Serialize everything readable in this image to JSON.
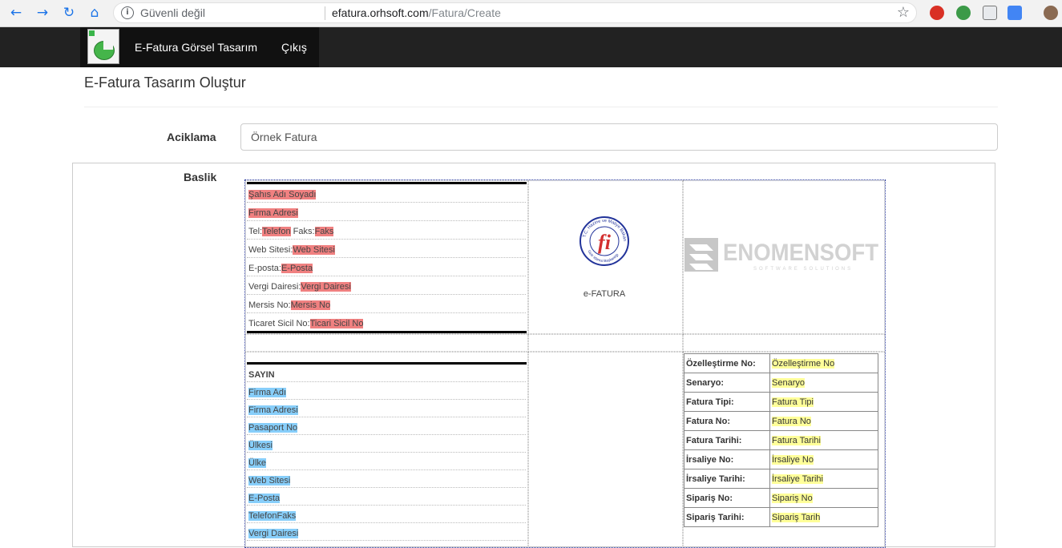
{
  "browser": {
    "security": "Güvenli değil",
    "host": "efatura.orhsoft.com",
    "path": "/Fatura/Create"
  },
  "app_nav": {
    "brand": "E-Fatura Görsel Tasarım",
    "logout": "Çıkış"
  },
  "page": {
    "title": "E-Fatura Tasarım Oluştur",
    "description_label": "Aciklama",
    "description_value": "Örnek Fatura",
    "header_label": "Baslik"
  },
  "seller": [
    {
      "prefix": "",
      "field": "Şahıs Adı Soyadı"
    },
    {
      "prefix": "",
      "field": "Firma Adresi"
    },
    {
      "prefix": "Tel:",
      "field": "Telefon",
      "prefix2": "Faks:",
      "field2": "Faks"
    },
    {
      "prefix": "Web Sitesi:",
      "field": "Web Sitesi"
    },
    {
      "prefix": "E-posta:",
      "field": "E-Posta"
    },
    {
      "prefix": "Vergi Dairesi:",
      "field": "Vergi Dairesi"
    },
    {
      "prefix": "Mersis No:",
      "field": "Mersis No"
    },
    {
      "prefix": "Ticaret Sicil No:",
      "field": "Ticari Sicil No"
    }
  ],
  "seal": {
    "letter": "fi",
    "ring_text": "T.C. Hazine ve Maliye Bakanlığı",
    "ring_text_bottom": "Gelir İdaresi Başkanlığı",
    "label": "e-FATURA"
  },
  "brand_logo": {
    "name": "ENOMENSOFT",
    "tagline": "SOFTWARE SOLUTIONS"
  },
  "buyer": {
    "heading": "SAYIN",
    "fields": [
      "Firma Adı",
      "Firma Adresi",
      "Pasaport No",
      "Ülkesi",
      "Ülke",
      "Web Sitesi",
      "E-Posta",
      "TelefonFaks",
      "Vergi Dairesi"
    ]
  },
  "invoice_info": [
    {
      "label": "Özelleştirme No:",
      "value": "Özelleştirme No"
    },
    {
      "label": "Senaryo:",
      "value": "Senaryo"
    },
    {
      "label": "Fatura Tipi:",
      "value": "Fatura Tipi"
    },
    {
      "label": "Fatura No:",
      "value": "Fatura No"
    },
    {
      "label": "Fatura Tarihi:",
      "value": "Fatura Tarihi"
    },
    {
      "label": "İrsaliye No:",
      "value": "İrsaliye No"
    },
    {
      "label": "İrsaliye Tarihi:",
      "value": "İrsaliye Tarihi"
    },
    {
      "label": "Sipariş No:",
      "value": "Sipariş No"
    },
    {
      "label": "Sipariş Tarihi:",
      "value": "Sipariş Tarih"
    }
  ],
  "colors": {
    "seller_highlight": "#f08080",
    "buyer_highlight": "#87cefa",
    "info_highlight": "#ffff99",
    "navbar": "#222222"
  }
}
